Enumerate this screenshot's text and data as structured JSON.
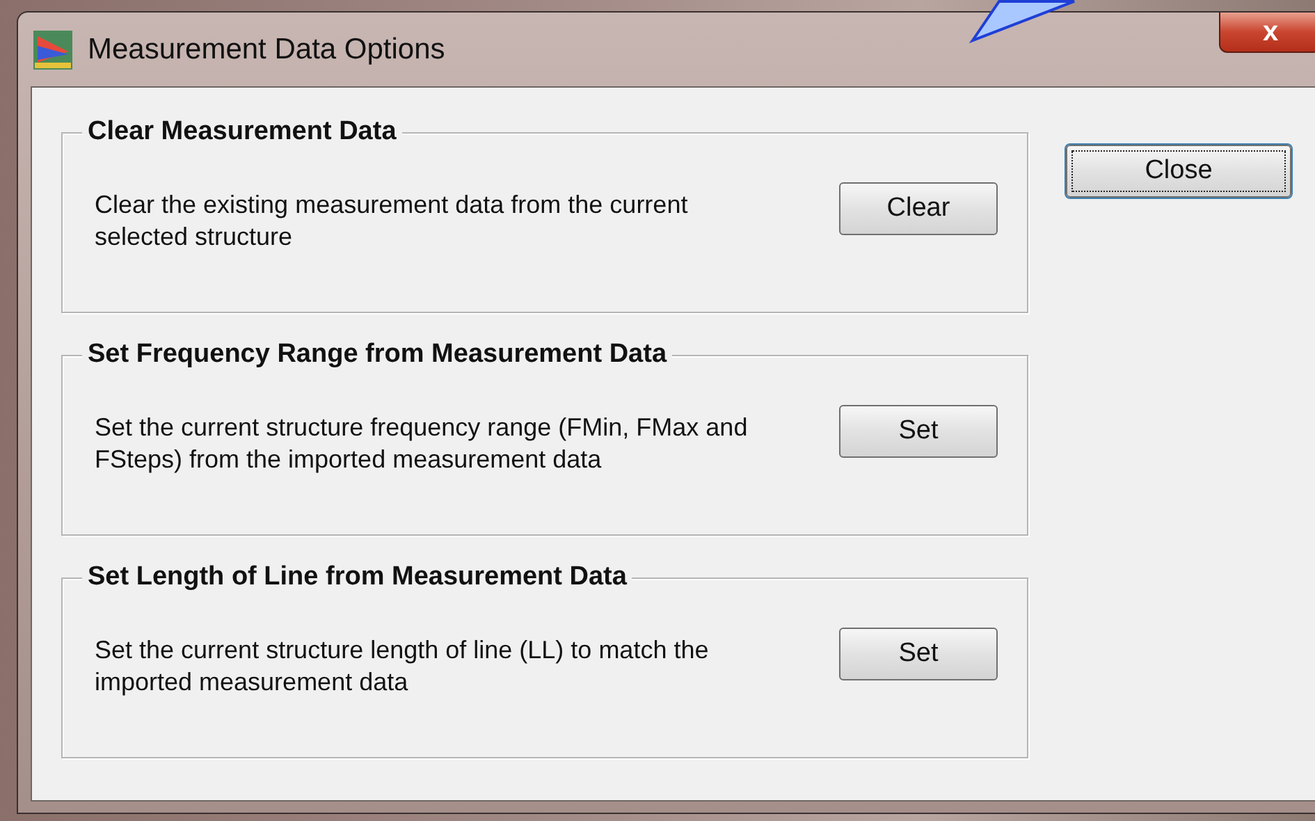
{
  "window": {
    "title": "Measurement Data Options",
    "close_glyph": "x"
  },
  "groups": [
    {
      "title": "Clear Measurement Data",
      "description": "Clear the existing measurement data from the current selected structure",
      "button": "Clear"
    },
    {
      "title": "Set Frequency Range from Measurement Data",
      "description": "Set the current structure frequency range (FMin, FMax and FSteps) from the imported measurement data",
      "button": "Set"
    },
    {
      "title": "Set Length of Line from Measurement Data",
      "description": "Set the current structure length of line (LL) to match the imported measurement data",
      "button": "Set"
    }
  ],
  "close_button": {
    "label": "Close",
    "focused": true
  }
}
